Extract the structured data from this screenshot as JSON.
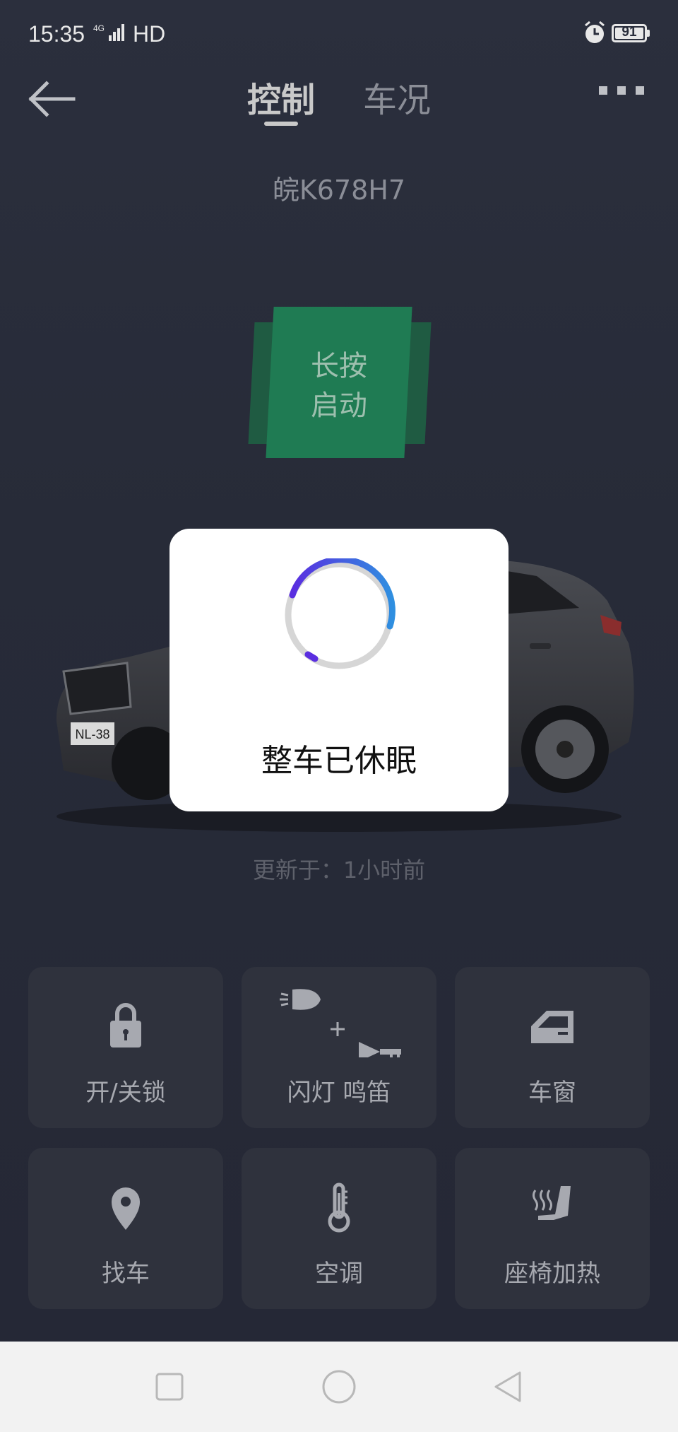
{
  "status_bar": {
    "time": "15:35",
    "signal": "4G",
    "hd": "HD",
    "battery": "91",
    "icons": [
      "alarm-icon",
      "battery-icon"
    ]
  },
  "header": {
    "tabs": [
      {
        "label": "控制",
        "active": true
      },
      {
        "label": "车况",
        "active": false
      }
    ],
    "icons": [
      "back-arrow-icon",
      "more-dots-icon"
    ]
  },
  "vehicle": {
    "plate": "皖K678H7",
    "front_plate_text": "NL-38",
    "start_button": {
      "line1": "长按",
      "line2": "启动"
    },
    "updated": "更新于：1小时前"
  },
  "controls": [
    {
      "label": "开/关锁",
      "icon": "lock-icon"
    },
    {
      "label": "闪灯 鸣笛",
      "icon": "flash-horn-icon"
    },
    {
      "label": "车窗",
      "icon": "window-icon"
    },
    {
      "label": "找车",
      "icon": "location-pin-icon"
    },
    {
      "label": "空调",
      "icon": "thermometer-icon"
    },
    {
      "label": "座椅加热",
      "icon": "seat-heat-icon"
    }
  ],
  "dialog": {
    "message": "整车已休眠",
    "icon": "loading-spinner-icon"
  },
  "navbar": {
    "icons": [
      "recents-square-icon",
      "home-circle-icon",
      "back-triangle-icon"
    ]
  },
  "colors": {
    "background": "#2a2e3c",
    "tile": "#2f323d",
    "start_green": "#1f7b53",
    "spinner_blue": "#2f8fe0",
    "spinner_purple": "#5a2ee0"
  }
}
